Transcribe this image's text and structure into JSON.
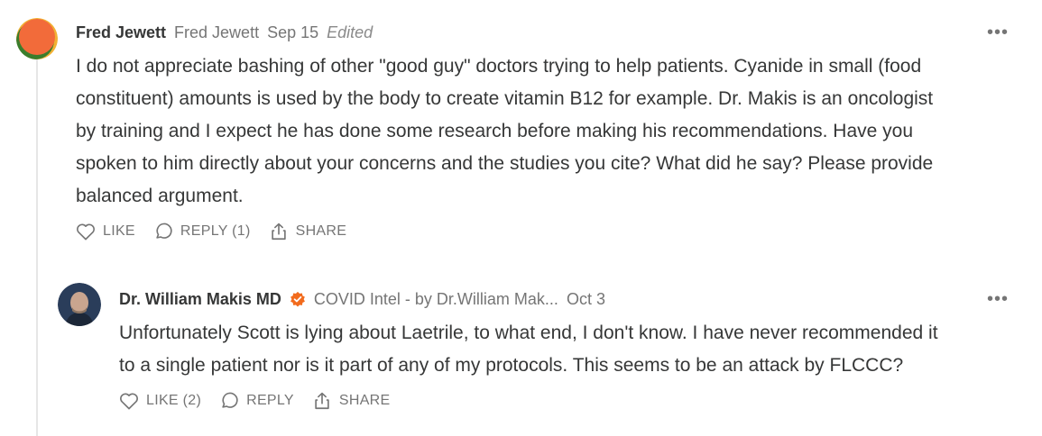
{
  "comments": [
    {
      "author": "Fred Jewett",
      "handle": "Fred Jewett",
      "date": "Sep 15",
      "edited": "Edited",
      "avatar_colors": [
        "#f26b3a",
        "#3a7d2c",
        "#f2b134"
      ],
      "lines": [
        "I do not appreciate bashing of other \"good guy\" doctors trying to help patients. Cyanide in small (food",
        "constituent) amounts is used by the body to create vitamin B12 for example. Dr. Makis is an oncologist",
        "by training and I expect he has done some research before making his recommendations. Have you",
        "spoken to him directly about your concerns and the studies you cite? What did he say? Please provide",
        "balanced argument."
      ],
      "actions": {
        "like": "LIKE",
        "reply": "REPLY (1)",
        "share": "SHARE"
      },
      "more_icon": "ellipsis-icon"
    },
    {
      "author": "Dr. William Makis MD",
      "publication": "COVID Intel - by Dr.William Mak...",
      "date": "Oct 3",
      "verified_color": "#f26b1d",
      "lines": [
        "Unfortunately Scott is lying about Laetrile, to what end, I don't know. I have never recommended it",
        "to a single patient nor is it part of any of my protocols. This seems to be an attack by FLCCC?"
      ],
      "actions": {
        "like": "LIKE (2)",
        "reply": "REPLY",
        "share": "SHARE"
      },
      "more_icon": "ellipsis-icon"
    }
  ]
}
